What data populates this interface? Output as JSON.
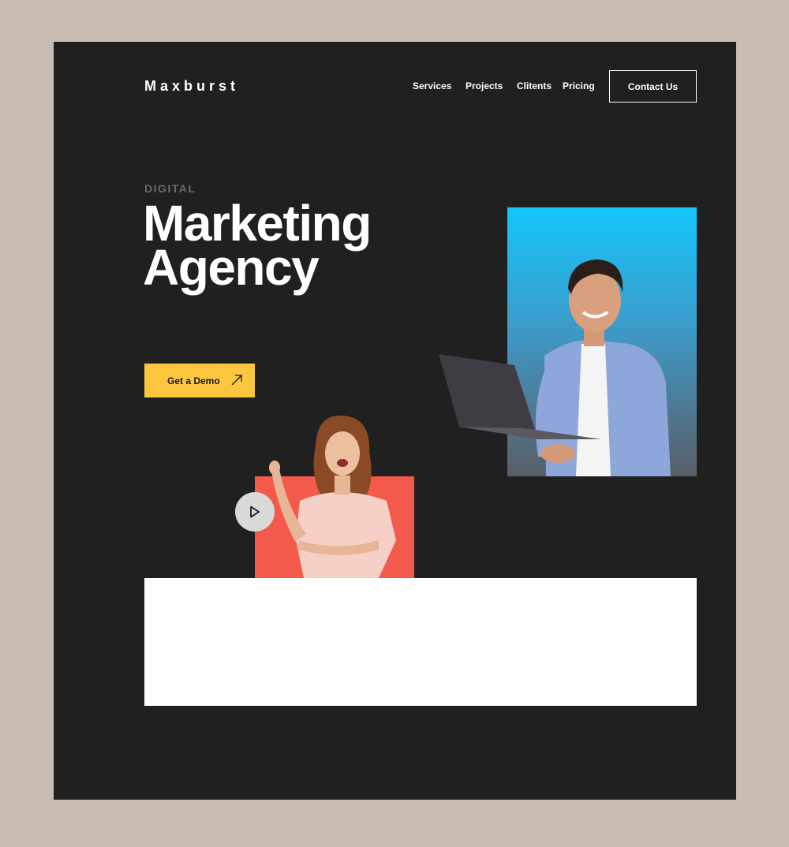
{
  "header": {
    "logo": "Maxburst",
    "nav": [
      "Services",
      "Projects",
      "Clitents",
      "Pricing"
    ],
    "contact_label": "Contact Us"
  },
  "hero": {
    "eyebrow": "DIGITAL",
    "title_line1": "Marketing",
    "title_line2": "Agency",
    "cta_label": "Get a Demo"
  },
  "icons": {
    "cta_icon": "arrow-up-right-icon",
    "play_icon": "play-icon"
  },
  "colors": {
    "page_bg": "#c8bcb3",
    "frame_bg": "#202020",
    "accent_yellow": "#fcc73f",
    "accent_coral": "#f45a4b",
    "accent_blue": "#14c6fb"
  }
}
